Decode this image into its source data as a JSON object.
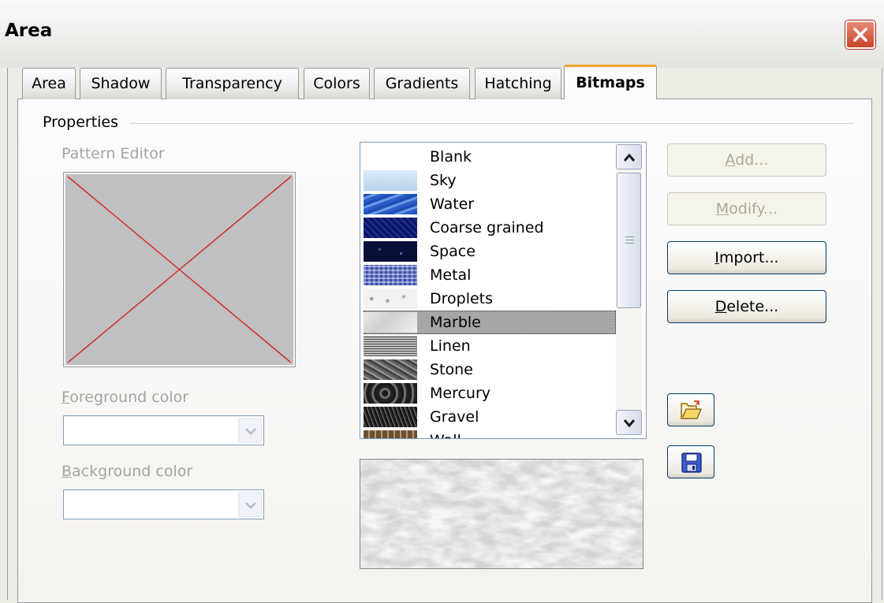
{
  "window": {
    "title": "Area"
  },
  "tabs": [
    {
      "label": "Area"
    },
    {
      "label": "Shadow"
    },
    {
      "label": "Transparency"
    },
    {
      "label": "Colors"
    },
    {
      "label": "Gradients"
    },
    {
      "label": "Hatching"
    },
    {
      "label": "Bitmaps",
      "active": true
    }
  ],
  "properties": {
    "section_label": "Properties",
    "pattern_editor_label": "Pattern Editor",
    "foreground_label_first": "F",
    "foreground_label_rest": "oreground color",
    "foreground_value": "",
    "background_label_first": "B",
    "background_label_rest": "ackground color",
    "background_value": ""
  },
  "bitmap_list": {
    "items": [
      {
        "label": "Blank"
      },
      {
        "label": "Sky"
      },
      {
        "label": "Water"
      },
      {
        "label": "Coarse grained"
      },
      {
        "label": "Space"
      },
      {
        "label": "Metal"
      },
      {
        "label": "Droplets"
      },
      {
        "label": "Marble",
        "selected": true
      },
      {
        "label": "Linen"
      },
      {
        "label": "Stone"
      },
      {
        "label": "Mercury"
      },
      {
        "label": "Gravel"
      },
      {
        "label": "Wall"
      }
    ],
    "selected": "Marble"
  },
  "buttons": {
    "add_mnemonic": "A",
    "add_rest": "dd...",
    "modify_mnemonic": "M",
    "modify_rest": "odify...",
    "import_mnemonic": "I",
    "import_rest": "mport...",
    "delete_mnemonic": "D",
    "delete_rest": "elete..."
  },
  "colors": {
    "tab_active_accent": "#f2a12b",
    "selection_bg": "#a6a6a6",
    "disabled_text": "#a4a4a4",
    "close_button": "#c64526"
  },
  "icons": {
    "close": "close-icon",
    "load": "open-folder-icon",
    "save": "save-disk-icon"
  }
}
